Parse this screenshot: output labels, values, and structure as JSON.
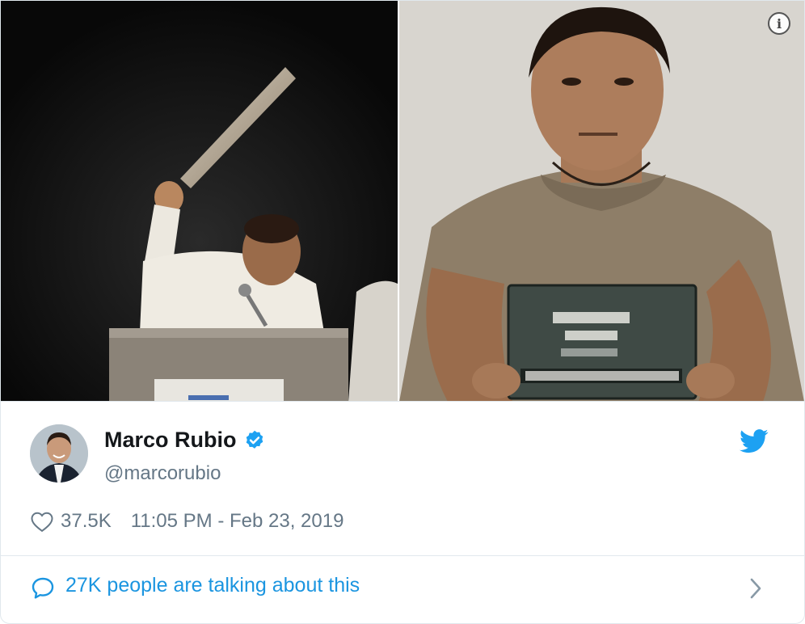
{
  "tweet": {
    "author": {
      "display_name": "Marco Rubio",
      "handle": "@marcorubio",
      "verified": true
    },
    "likes": "37.5K",
    "timestamp": "11:05 PM - Feb 23, 2019",
    "conversation_text": "27K people are talking about this"
  },
  "icons": {
    "info": "info-icon",
    "verified": "verified-badge-icon",
    "brand": "twitter-bird-icon",
    "like": "heart-icon",
    "conversation": "speech-bubble-icon",
    "chevron": "chevron-right-icon"
  },
  "colors": {
    "twitter_blue": "#1da1f2",
    "link_blue": "#1b95e0",
    "secondary_text": "#657786",
    "border": "#e1e8ed"
  }
}
